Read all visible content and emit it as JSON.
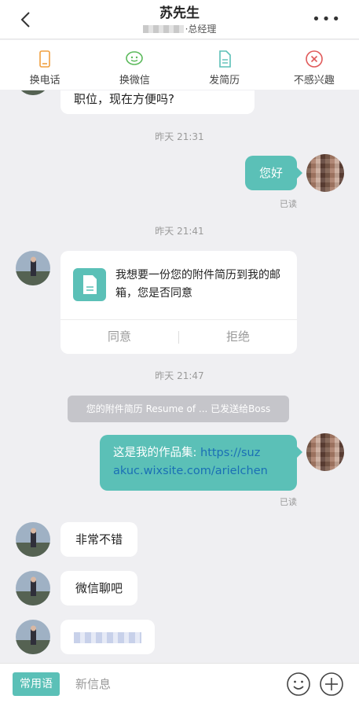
{
  "header": {
    "title": "苏先生",
    "subtitle_role": "·总经理"
  },
  "actions": [
    {
      "label": "换电话",
      "icon": "phone-icon"
    },
    {
      "label": "换微信",
      "icon": "wechat-icon"
    },
    {
      "label": "发简历",
      "icon": "resume-icon"
    },
    {
      "label": "不感兴趣",
      "icon": "not-interested-icon"
    }
  ],
  "messages": {
    "partial_text": "职位，现在方便吗?",
    "time1": "昨天 21:31",
    "hello": "您好",
    "read1": "已读",
    "time2": "昨天 21:41",
    "card": {
      "text": "我想要一份您的附件简历到我的邮箱，您是否同意",
      "agree": "同意",
      "reject": "拒绝"
    },
    "time3": "昨天 21:47",
    "notice": "您的附件简历 Resume of ... 已发送给Boss",
    "portfolio_prefix": "这是我的作品集: ",
    "portfolio_link_1": "https://suz",
    "portfolio_link_2": "akuc.wixsite.com/arielchen",
    "read2": "已读",
    "reply1": "非常不错",
    "reply2": "微信聊吧"
  },
  "input": {
    "quick_label": "常用语",
    "placeholder": "新信息"
  },
  "colors": {
    "accent": "#5bc0b7",
    "link": "#1a6fb5",
    "background": "#efeff2"
  }
}
